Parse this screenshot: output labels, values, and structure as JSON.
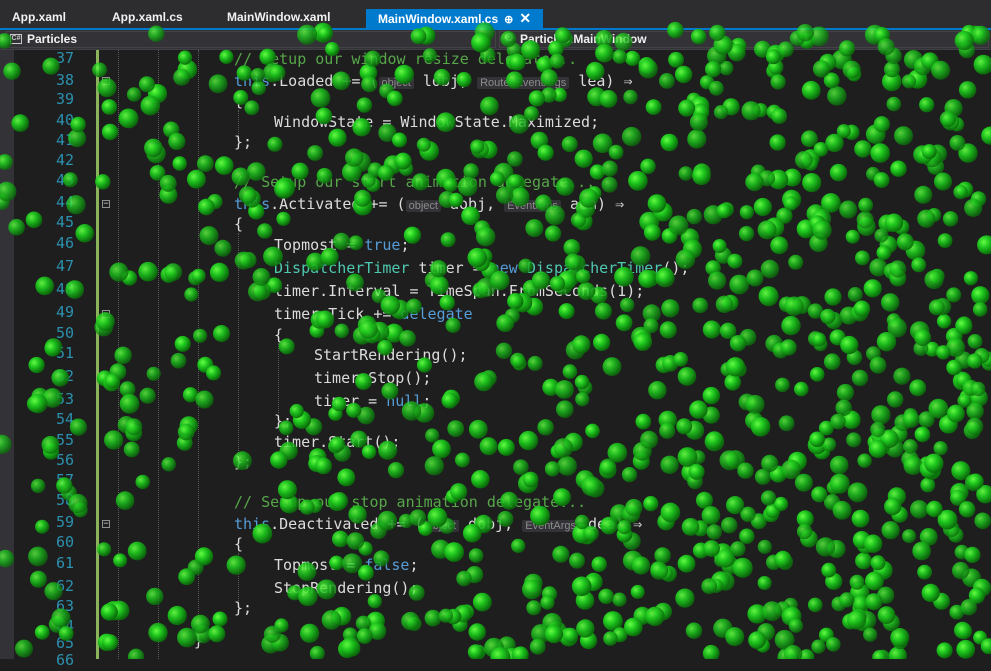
{
  "tabs": [
    {
      "label": "App.xaml",
      "active": false
    },
    {
      "label": "App.xaml.cs",
      "active": false
    },
    {
      "label": "MainWindow.xaml",
      "active": false
    },
    {
      "label": "MainWindow.xaml.cs",
      "active": true
    }
  ],
  "tab_pin_glyph": "⊕",
  "tab_close_glyph": "✕",
  "navbar": {
    "project": "Particles",
    "project_icon": "C#",
    "member": "Particles.MainWindow"
  },
  "lines": [
    {
      "n": "37"
    },
    {
      "n": "38"
    },
    {
      "n": "39"
    },
    {
      "n": "40"
    },
    {
      "n": "41"
    },
    {
      "n": "42"
    },
    {
      "n": "43"
    },
    {
      "n": "44"
    },
    {
      "n": "45"
    },
    {
      "n": "46"
    },
    {
      "n": "47"
    },
    {
      "n": "48"
    },
    {
      "n": "49"
    },
    {
      "n": "50"
    },
    {
      "n": "51"
    },
    {
      "n": "52"
    },
    {
      "n": "53"
    },
    {
      "n": "54"
    },
    {
      "n": "55"
    },
    {
      "n": "56"
    },
    {
      "n": "57"
    },
    {
      "n": "58"
    },
    {
      "n": "59"
    },
    {
      "n": "60"
    },
    {
      "n": "61"
    },
    {
      "n": "62"
    },
    {
      "n": "63"
    },
    {
      "n": "64"
    },
    {
      "n": "65"
    },
    {
      "n": "66"
    }
  ],
  "code": {
    "l37": "// Setup our window resize delegate...",
    "l38_this": "this",
    "l38_a": ".Loaded += (",
    "l38_h1": "object",
    "l38_b": " lobj, ",
    "l38_h2": "RoutedEventArgs",
    "l38_c": " lea) ⇒",
    "l39": "{",
    "l40": "WindowState = WindowState.Maximized;",
    "l41": "};",
    "l43": "// Setup our start animation delegate...",
    "l44_this": "this",
    "l44_a": ".Activated += (",
    "l44_h1": "object",
    "l44_b": " aobj, ",
    "l44_h2": "EventArgs",
    "l44_c": " aea) ⇒",
    "l45": "{",
    "l46_a": "Topmost = ",
    "l46_kw": "true",
    "l46_b": ";",
    "l47_ty1": "DispatcherTimer",
    "l47_a": " timer = ",
    "l47_kw": "new",
    "l47_ty2": " DispatcherTimer",
    "l47_b": "();",
    "l48": "timer.Interval = TimeSpan.FromSeconds(1);",
    "l49_a": "timer.Tick += ",
    "l49_kw": "delegate",
    "l50": "{",
    "l51": "StartRendering();",
    "l52": "timer.Stop();",
    "l53_a": "timer = ",
    "l53_kw": "null",
    "l53_b": ";",
    "l54": "};",
    "l55": "timer.Start();",
    "l56": "};",
    "l58": "// Setup our stop animation delegate...",
    "l59_this": "this",
    "l59_a": ".Deactivated += (",
    "l59_h1": "object",
    "l59_b": " dobj, ",
    "l59_h2": "EventArgs",
    "l59_c": " dea) ⇒",
    "l60": "{",
    "l61_a": "Topmost = ",
    "l61_kw": "false",
    "l61_b": ";",
    "l62": "StopRendering();",
    "l63": "};",
    "l65": "}"
  },
  "colors": {
    "particle_core": "#66ff44",
    "particle_mid": "#1ec81e",
    "particle_edge": "#0a6e0a"
  }
}
